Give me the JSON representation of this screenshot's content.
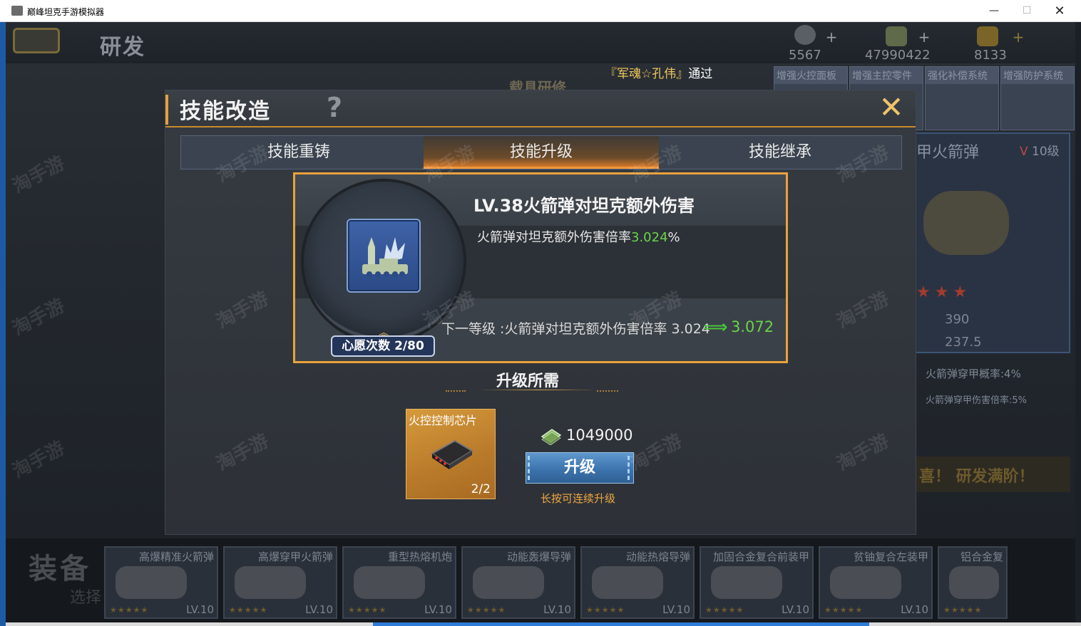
{
  "window": {
    "title": "巅峰坦克手游模拟器",
    "minimize_symbol": "—",
    "maximize_symbol": "☐",
    "close_symbol": "✕"
  },
  "topbar": {
    "page_title": "研发",
    "resources": [
      {
        "icon": "medal-icon",
        "value": "5567"
      },
      {
        "icon": "money-icon",
        "value": "47990422"
      },
      {
        "icon": "gold-icon",
        "value": "8133"
      }
    ],
    "plus_symbol": "+"
  },
  "notice": {
    "highlight": "『军魂☆孔伟』",
    "text": "通过"
  },
  "background": {
    "faded_label": "载具研修",
    "right_tabs": [
      "增强火控面板",
      "增强主控零件",
      "强化补偿系统",
      "增强防护系统"
    ],
    "right_panel": {
      "title": "甲火箭弹",
      "level_prefix": "V",
      "level": "10级",
      "stars": "★★★",
      "value1": "390",
      "value2": "237.5"
    },
    "stat1": "火箭弹穿甲概率:4%",
    "stat2": "火箭弹穿甲伤害倍率:5%",
    "banner": "喜！ 研发满阶！",
    "equip_label": "装备",
    "equip_label2": "选择",
    "equipment": [
      {
        "name": "高爆精准火箭弹",
        "level": "LV.10",
        "stars": "★★★★★"
      },
      {
        "name": "高爆穿甲火箭弹",
        "level": "LV.10",
        "stars": "★★★★★"
      },
      {
        "name": "重型热熔机炮",
        "level": "LV.10",
        "stars": "★★★★★"
      },
      {
        "name": "动能轰爆导弹",
        "level": "LV.10",
        "stars": "★★★★★"
      },
      {
        "name": "动能热熔导弹",
        "level": "LV.10",
        "stars": "★★★★★"
      },
      {
        "name": "加固合金复合前装甲",
        "level": "LV.10",
        "stars": "★★★★★"
      },
      {
        "name": "贫铀复合左装甲",
        "level": "LV.10",
        "stars": "★★★★★"
      },
      {
        "name": "铝合金复",
        "level": "",
        "stars": "★★★★★"
      }
    ]
  },
  "dialog": {
    "title": "技能改造",
    "help_symbol": "?",
    "close_symbol": "✕",
    "tabs": [
      {
        "label": "技能重铸",
        "active": false
      },
      {
        "label": "技能升级",
        "active": true
      },
      {
        "label": "技能继承",
        "active": false
      }
    ],
    "skill": {
      "name": "LV.38火箭弹对坦克额外伤害",
      "desc_prefix": "火箭弹对坦克额外伤害倍率",
      "desc_value": "3.024",
      "desc_suffix": "%",
      "next_line": "下一等级 :火箭弹对坦克额外伤害倍率 3.024",
      "arrow_symbol": "⟹",
      "next_value": "3.072",
      "wish_label": "心愿次数 2/80",
      "chevron_symbol": "︽"
    },
    "requirements": {
      "title": "升级所需",
      "material_name": "火控控制芯片",
      "material_count": "2/2",
      "cost": "1049000",
      "upgrade_label": "升级",
      "hint": "长按可连续升级"
    },
    "watermark": "淘手游"
  },
  "colors": {
    "accent_orange": "#e9a23c",
    "green_value": "#6bd34a",
    "button_blue": "#3d74ad",
    "hint_orange": "#f0a642"
  }
}
